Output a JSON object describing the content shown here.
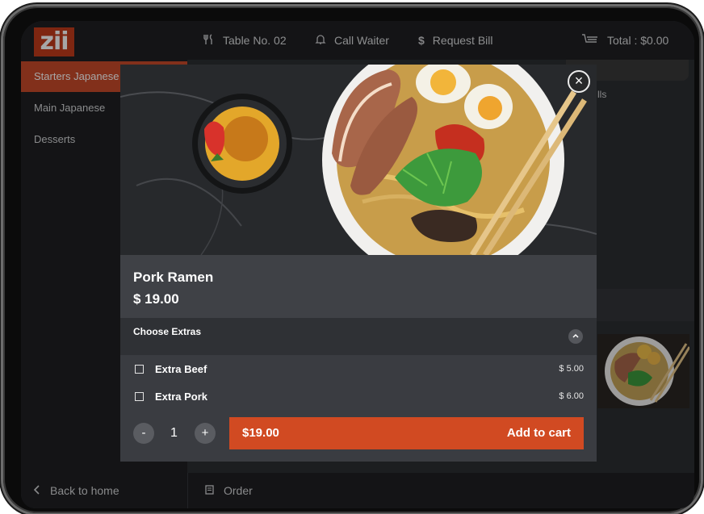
{
  "header": {
    "logo": "zii",
    "table": "Table No. 02",
    "call_waiter": "Call Waiter",
    "request_bill": "Request Bill",
    "total": "Total : $0.00"
  },
  "icons": {
    "table": "fork-knife-icon",
    "waiter": "bell-icon",
    "bill": "dollar-icon",
    "cart": "cart-icon",
    "back": "chevron-left-icon",
    "order": "receipt-icon",
    "close": "close-icon",
    "collapse": "chevron-up-icon"
  },
  "sidebar": {
    "items": [
      {
        "label": "Starters Japanese",
        "active": true
      },
      {
        "label": "Main Japanese"
      },
      {
        "label": "Desserts"
      }
    ]
  },
  "background": {
    "partial_text": "lls"
  },
  "bottom": {
    "back": "Back to home",
    "order": "Order"
  },
  "modal": {
    "dish_name": "Pork Ramen",
    "dish_price": "$ 19.00",
    "extras_title": "Choose Extras",
    "extras": [
      {
        "label": "Extra Beef",
        "price": "$ 5.00"
      },
      {
        "label": "Extra Pork",
        "price": "$ 6.00"
      }
    ],
    "quantity": "1",
    "minus": "-",
    "plus": "+",
    "cart_total": "$19.00",
    "add_to_cart": "Add to cart"
  },
  "colors": {
    "accent": "#d14a22",
    "logo_bg": "#c23b1b",
    "sidebar_active": "#c84a2a",
    "panel": "#1f2023"
  }
}
